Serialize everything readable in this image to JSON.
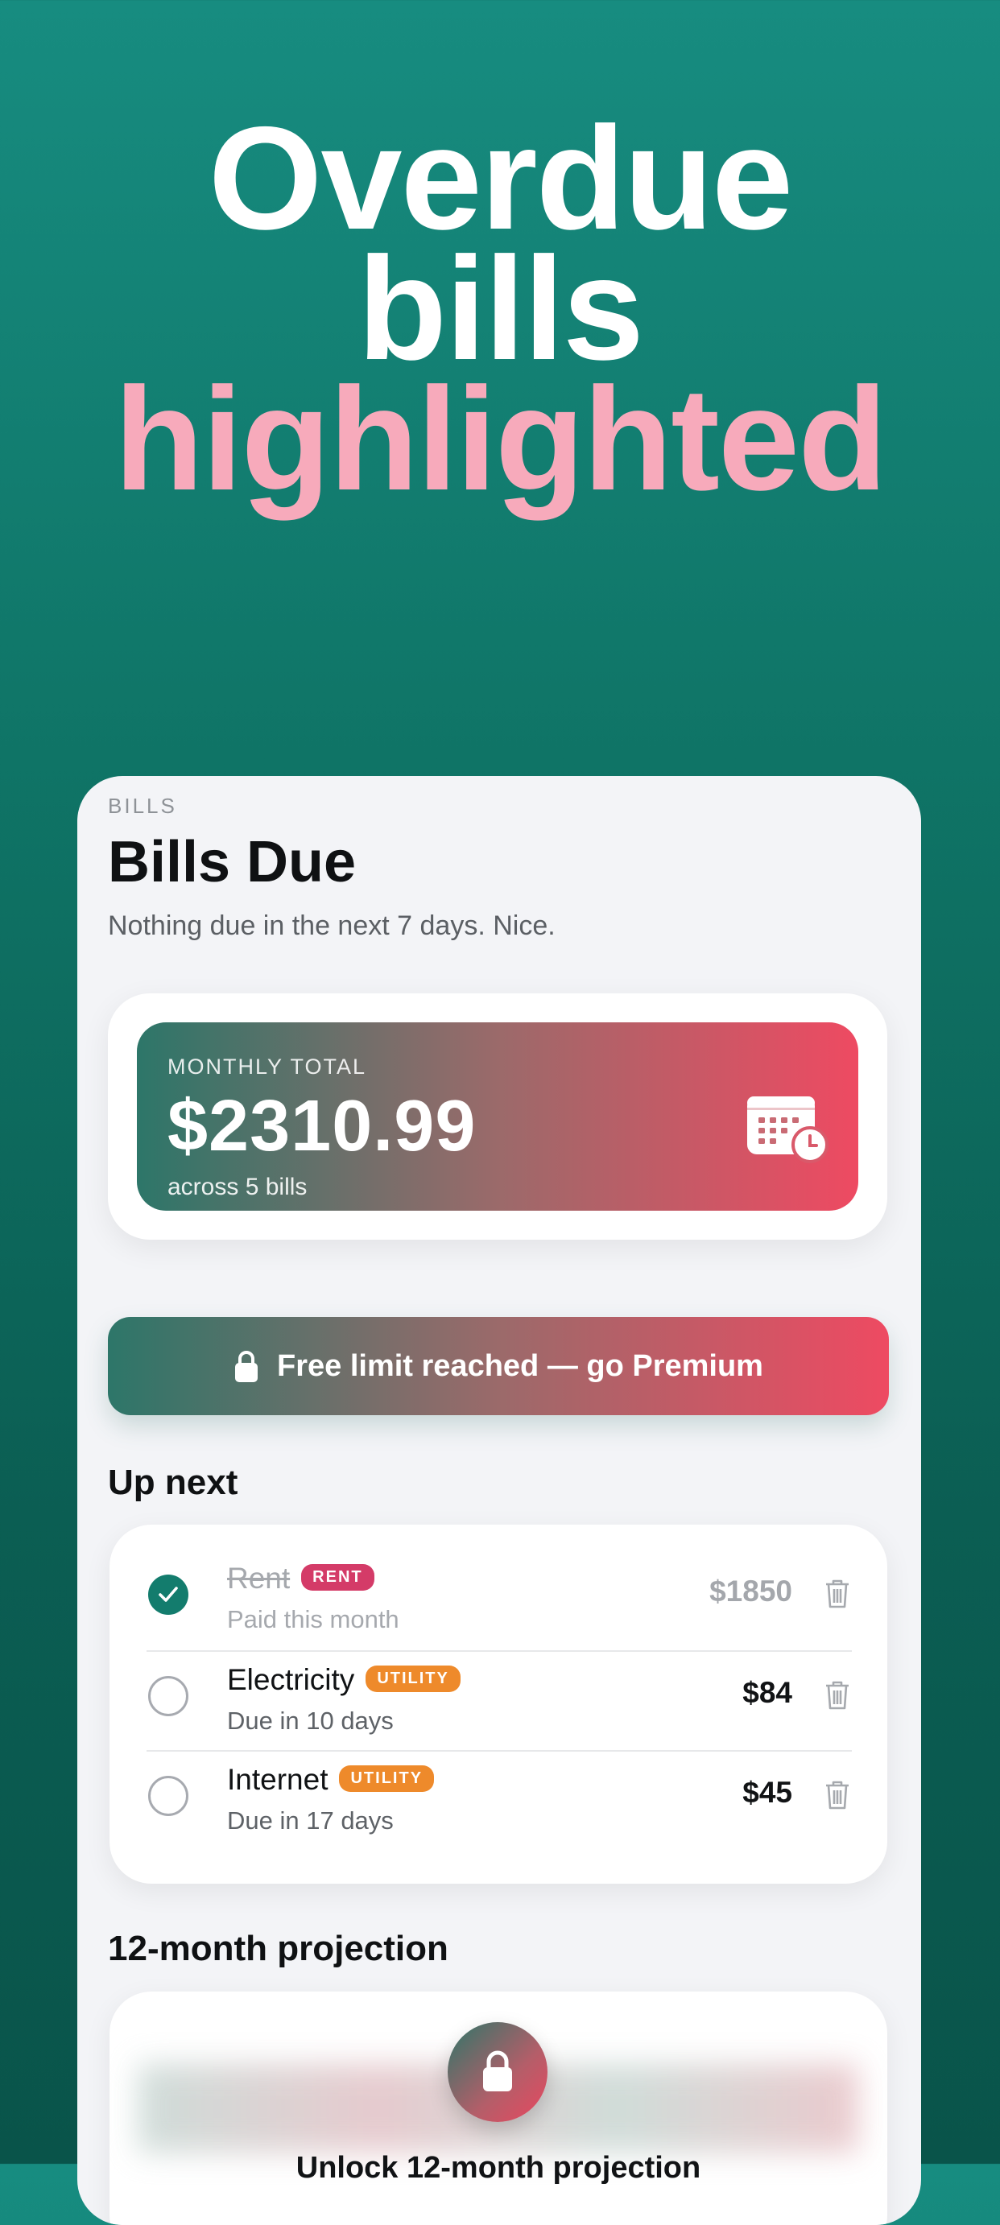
{
  "headline": {
    "line1": "Overdue",
    "line2": "bills",
    "line3": "highlighted"
  },
  "screen": {
    "eyebrow": "BILLS",
    "title": "Bills Due",
    "subtitle": "Nothing due in the next 7 days. Nice.",
    "summary": {
      "label": "MONTHLY TOTAL",
      "amount": "$2310.99",
      "count": "across 5 bills",
      "icon": "calendar-clock-icon"
    },
    "premium_button": {
      "label": "Free limit reached — go Premium",
      "icon": "lock-icon"
    },
    "up_next": {
      "title": "Up next",
      "items": [
        {
          "name": "Rent",
          "tag": "RENT",
          "status": "Paid this month",
          "amount": "$1850",
          "paid": true
        },
        {
          "name": "Electricity",
          "tag": "UTILITY",
          "status": "Due in 10 days",
          "amount": "$84",
          "paid": false
        },
        {
          "name": "Internet",
          "tag": "UTILITY",
          "status": "Due in 17 days",
          "amount": "$45",
          "paid": false
        }
      ]
    },
    "projection": {
      "title": "12-month projection",
      "unlock_label": "Unlock 12-month projection"
    }
  },
  "colors": {
    "background_top": "#178c80",
    "background_bottom": "#09544a",
    "headline_accent": "#f7aabb",
    "gradient_start": "#2d7669",
    "gradient_end": "#ee4a62",
    "tag_rent": "#d43b68",
    "tag_utility": "#ee8a2b",
    "check_done": "#137c6d"
  }
}
